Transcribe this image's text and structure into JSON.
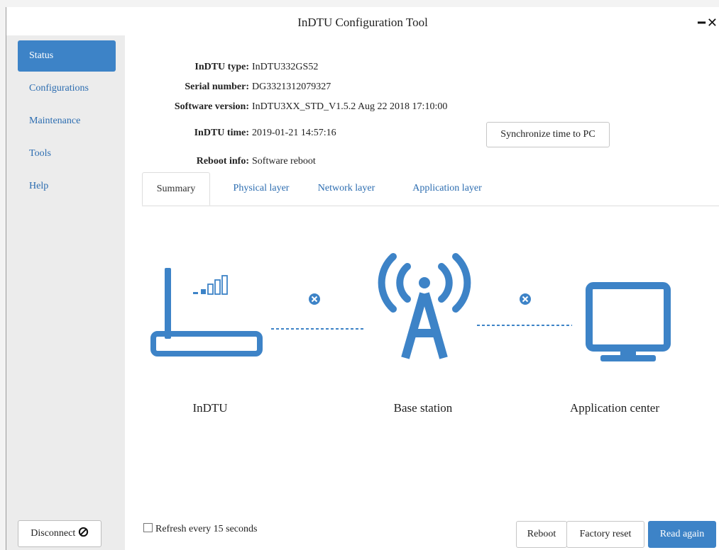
{
  "window": {
    "title": "InDTU Configuration Tool"
  },
  "sidebar": {
    "items": [
      {
        "label": "Status"
      },
      {
        "label": "Configurations"
      },
      {
        "label": "Maintenance"
      },
      {
        "label": "Tools"
      },
      {
        "label": "Help"
      }
    ],
    "disconnect_label": "Disconnect"
  },
  "info": {
    "type_label": "InDTU type:",
    "type_value": "InDTU332GS52",
    "serial_label": "Serial number:",
    "serial_value": "DG3321312079327",
    "software_label": "Software version:",
    "software_value": "InDTU3XX_STD_V1.5.2 Aug 22 2018 17:10:00",
    "time_label": "InDTU time:",
    "time_value": "2019-01-21 14:57:16",
    "reboot_label": "Reboot info:",
    "reboot_value": "Software reboot",
    "sync_button": "Synchronize time to PC"
  },
  "tabs": [
    {
      "label": "Summary"
    },
    {
      "label": "Physical layer"
    },
    {
      "label": "Network layer"
    },
    {
      "label": "Application layer"
    }
  ],
  "diagram": {
    "device_label": "InDTU",
    "station_label": "Base station",
    "center_label": "Application center",
    "link_status": "disconnected",
    "icon_color": "#3d83c7"
  },
  "footer": {
    "refresh_label": "Refresh every 15 seconds",
    "refresh_checked": false,
    "reboot_button": "Reboot",
    "factory_reset_button": "Factory reset",
    "read_again_button": "Read again"
  }
}
